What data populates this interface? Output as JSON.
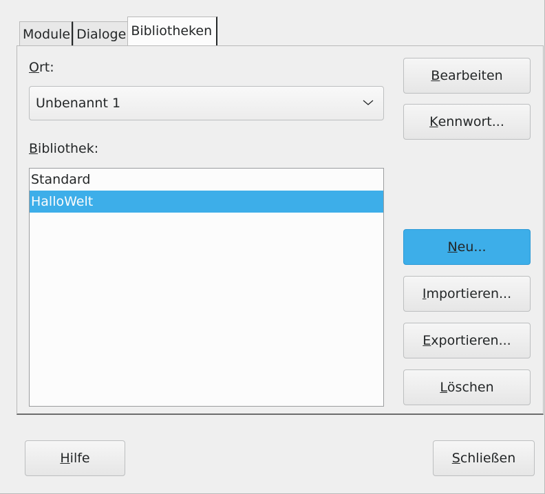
{
  "tabs": [
    {
      "label": "Module",
      "active": false
    },
    {
      "label": "Dialoge",
      "active": false
    },
    {
      "label": "Bibliotheken",
      "active": true
    }
  ],
  "location": {
    "label_first": "O",
    "label_rest": "rt:",
    "selected": "Unbenannt 1"
  },
  "library": {
    "label_first": "B",
    "label_rest": "ibliothek:",
    "items": [
      "Standard",
      "HalloWelt"
    ],
    "selected_index": 1
  },
  "buttons": {
    "edit": {
      "first": "B",
      "rest": "earbeiten"
    },
    "password": {
      "first": "K",
      "rest": "ennwort..."
    },
    "new": {
      "first": "N",
      "rest": "eu..."
    },
    "import": {
      "first": "I",
      "rest": "mportieren..."
    },
    "export": {
      "first": "E",
      "rest": "xportieren..."
    },
    "delete": {
      "first": "L",
      "rest": "öschen"
    },
    "help": {
      "first": "H",
      "rest": "ilfe"
    },
    "close": {
      "first": "S",
      "rest": "chließen"
    }
  },
  "colors": {
    "accent": "#3daee9",
    "background": "#efefef"
  }
}
